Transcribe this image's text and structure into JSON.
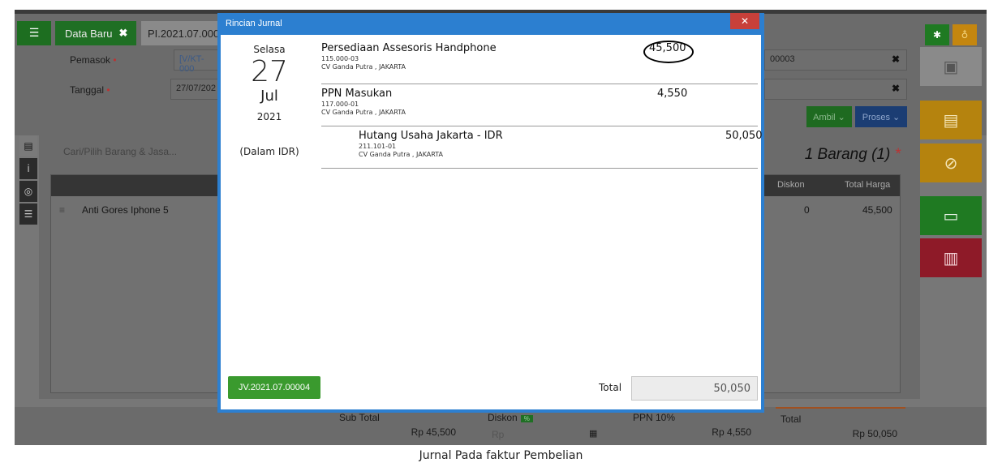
{
  "tabs": {
    "new_label": "Data Baru",
    "new_close": "✖",
    "doc_label": "PI.2021.07.000"
  },
  "form": {
    "pemasok_label": "Pemasok",
    "pemasok_value": "[V/KT-000",
    "tanggal_label": "Tanggal",
    "tanggal_value": "27/07/202",
    "required_mark": "•",
    "right_field_1": "00003",
    "clear_symbol": "✖"
  },
  "actions": {
    "ambil": "Ambil ⌄",
    "proses": "Proses ⌄"
  },
  "list": {
    "search_placeholder": "Cari/Pilih Barang & Jasa...",
    "count_label": "1 Barang (1)",
    "columns": {
      "diskon": "Diskon",
      "total_harga": "Total Harga"
    },
    "rows": [
      {
        "name": "Anti Gores Iphone 5",
        "diskon": "0",
        "total": "45,500"
      }
    ]
  },
  "footer": {
    "subtotal_label": "Sub Total",
    "subtotal_value": "Rp 45,500",
    "diskon_label": "Diskon",
    "diskon_badge": "%",
    "diskon_placeholder": "Rp",
    "ppn_label": "PPN 10%",
    "ppn_value": "Rp 4,550",
    "total_label": "Total",
    "total_value": "Rp 50,050"
  },
  "modal": {
    "title": "Rincian Jurnal",
    "close": "✕",
    "date": {
      "day_name": "Selasa",
      "day": "27",
      "month": "Jul",
      "year": "2021",
      "currency_note": "(Dalam IDR)"
    },
    "entries": [
      {
        "account": "Persediaan Assesoris Handphone",
        "code": "115.000-03",
        "party": "CV Ganda Putra , JAKARTA",
        "debit": "45,500",
        "credit": ""
      },
      {
        "account": "PPN Masukan",
        "code": "117.000-01",
        "party": "CV Ganda Putra , JAKARTA",
        "debit": "4,550",
        "credit": ""
      },
      {
        "account": "Hutang Usaha Jakarta - IDR",
        "code": "211.101-01",
        "party": "CV Ganda Putra , JAKARTA",
        "debit": "",
        "credit": "50,050"
      }
    ],
    "voucher": "JV.2021.07.00004",
    "total_label": "Total",
    "total_value": "50,050"
  },
  "caption": "Jurnal Pada faktur Pembelian",
  "colors": {
    "modal_border": "#2c7fd0",
    "close_red": "#c8403a",
    "voucher_green": "#3a9a2e"
  }
}
